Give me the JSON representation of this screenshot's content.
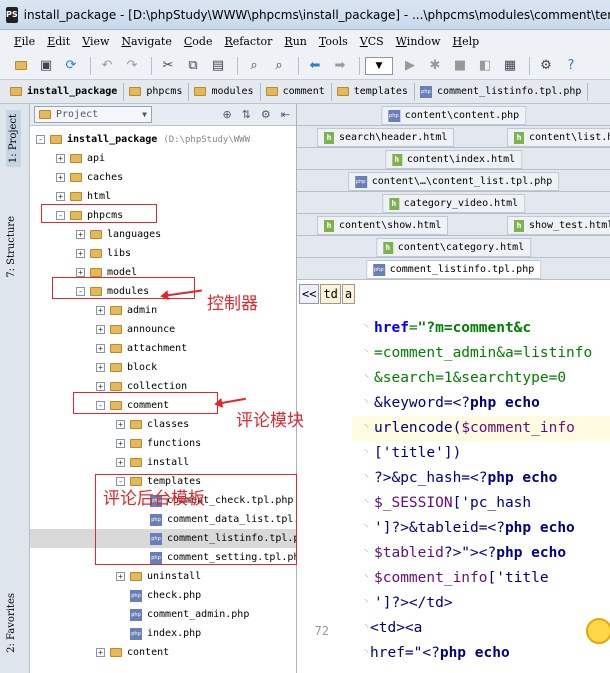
{
  "window": {
    "title": "install_package - [D:\\phpStudy\\WWW\\phpcms\\install_package] - ...\\phpcms\\modules\\comment\\templates\\comment_listinfo.tpl.php - PhpStorm",
    "app_icon": "PS"
  },
  "menu": [
    "File",
    "Edit",
    "View",
    "Navigate",
    "Code",
    "Refactor",
    "Run",
    "Tools",
    "VCS",
    "Window",
    "Help"
  ],
  "toolbar": {
    "icons": [
      "open-folder-icon",
      "save-icon",
      "sync-icon",
      "undo-icon",
      "redo-icon",
      "cut-icon",
      "copy-icon",
      "paste-icon",
      "find-icon",
      "replace-icon",
      "back-icon",
      "forward-icon",
      "run-config-dropdown",
      "run-icon",
      "debug-icon",
      "stop-icon",
      "settings-icon",
      "help-icon"
    ]
  },
  "breadcrumb": [
    "install_package",
    "phpcms",
    "modules",
    "comment",
    "templates",
    "comment_listinfo.tpl.php"
  ],
  "left_tabs": {
    "project": "1: Project",
    "structure": "7: Structure",
    "favorites": "2: Favorites"
  },
  "project": {
    "selector": "Project",
    "root_label": "install_package",
    "root_path": "(D:\\phpStudy\\WWW",
    "tree": [
      {
        "label": "api",
        "type": "folder",
        "depth": 1,
        "exp": "+"
      },
      {
        "label": "caches",
        "type": "folder",
        "depth": 1,
        "exp": "+"
      },
      {
        "label": "html",
        "type": "folder",
        "depth": 1,
        "exp": "+"
      },
      {
        "label": "phpcms",
        "type": "folder",
        "depth": 1,
        "exp": "-"
      },
      {
        "label": "languages",
        "type": "folder",
        "depth": 2,
        "exp": "+"
      },
      {
        "label": "libs",
        "type": "folder",
        "depth": 2,
        "exp": "+"
      },
      {
        "label": "model",
        "type": "folder",
        "depth": 2,
        "exp": "+"
      },
      {
        "label": "modules",
        "type": "folder",
        "depth": 2,
        "exp": "-"
      },
      {
        "label": "admin",
        "type": "folder",
        "depth": 3,
        "exp": "+"
      },
      {
        "label": "announce",
        "type": "folder",
        "depth": 3,
        "exp": "+"
      },
      {
        "label": "attachment",
        "type": "folder",
        "depth": 3,
        "exp": "+"
      },
      {
        "label": "block",
        "type": "folder",
        "depth": 3,
        "exp": "+"
      },
      {
        "label": "collection",
        "type": "folder",
        "depth": 3,
        "exp": "+"
      },
      {
        "label": "comment",
        "type": "folder",
        "depth": 3,
        "exp": "-"
      },
      {
        "label": "classes",
        "type": "folder",
        "depth": 4,
        "exp": "+"
      },
      {
        "label": "functions",
        "type": "folder",
        "depth": 4,
        "exp": "+"
      },
      {
        "label": "install",
        "type": "folder",
        "depth": 4,
        "exp": "+"
      },
      {
        "label": "templates",
        "type": "folder",
        "depth": 4,
        "exp": "-"
      },
      {
        "label": "comment_check.tpl.php",
        "type": "php",
        "depth": 5,
        "exp": ""
      },
      {
        "label": "comment_data_list.tpl.php",
        "type": "php",
        "depth": 5,
        "exp": ""
      },
      {
        "label": "comment_listinfo.tpl.php",
        "type": "php",
        "depth": 5,
        "exp": "",
        "selected": true
      },
      {
        "label": "comment_setting.tpl.php",
        "type": "php",
        "depth": 5,
        "exp": ""
      },
      {
        "label": "uninstall",
        "type": "folder",
        "depth": 4,
        "exp": "+"
      },
      {
        "label": "check.php",
        "type": "php",
        "depth": 4,
        "exp": ""
      },
      {
        "label": "comment_admin.php",
        "type": "php",
        "depth": 4,
        "exp": ""
      },
      {
        "label": "index.php",
        "type": "php",
        "depth": 4,
        "exp": ""
      },
      {
        "label": "content",
        "type": "folder",
        "depth": 3,
        "exp": "+"
      }
    ]
  },
  "annotations": {
    "controller": "控制器",
    "comment_module": "评论模块",
    "comment_template": "评论后台模板"
  },
  "editor_tabs": [
    {
      "label": "content\\content.php",
      "type": "php",
      "row": 0,
      "col": "c"
    },
    {
      "label": "search\\header.html",
      "type": "h",
      "row": 1,
      "col": "l"
    },
    {
      "label": "content\\list.html",
      "type": "h",
      "row": 1,
      "col": "r"
    },
    {
      "label": "content\\index.html",
      "type": "h",
      "row": 2,
      "col": "c"
    },
    {
      "label": "content\\…\\content_list.tpl.php",
      "type": "php",
      "row": 3,
      "col": "c"
    },
    {
      "label": "category_video.html",
      "type": "h",
      "row": 4,
      "col": "c"
    },
    {
      "label": "content\\show.html",
      "type": "h",
      "row": 5,
      "col": "l"
    },
    {
      "label": "show_test.html",
      "type": "h",
      "row": 5,
      "col": "r"
    },
    {
      "label": "content\\category.html",
      "type": "h",
      "row": 6,
      "col": "c"
    },
    {
      "label": "comment_listinfo.tpl.php",
      "type": "php",
      "row": 7,
      "col": "c",
      "active": true
    }
  ],
  "code_nav": [
    "<<",
    "td",
    "a"
  ],
  "code": {
    "line_number": "72",
    "lines": [
      " href=\"?m=comment&c",
      "=comment_admin&a=listinfo",
      "&search=1&searchtype=0",
      "&keyword=<?php echo",
      "urlencode($comment_info",
      "['title'])",
      "?>&pc_hash=<?php echo",
      "$_SESSION['pc_hash",
      "']?>&tableid=<?php echo",
      "$tableid?>\"><?php echo",
      "$comment_info['title",
      "']?></td>",
      "        <td><a",
      "href=\"<?php echo"
    ]
  }
}
